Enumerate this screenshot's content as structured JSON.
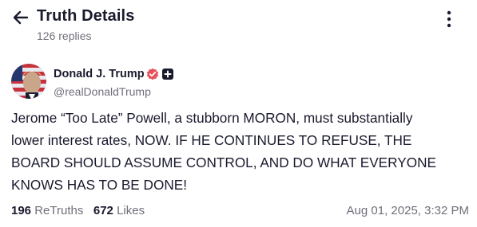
{
  "header": {
    "title": "Truth Details",
    "replies": "126 replies",
    "back_icon": "arrow-left-icon",
    "more_icon": "vertical-ellipsis-icon"
  },
  "post": {
    "author_name": "Donald J. Trump",
    "author_handle": "@realDonaldTrump",
    "verified_icon": "verified-badge-icon",
    "verified_color": "#e8505b",
    "plus_icon": "plus-badge-icon",
    "text_lines": [
      "Jerome “Too Late” Powell, a stubborn MORON, must substantially",
      "lower interest rates, NOW. IF HE CONTINUES TO REFUSE, THE",
      "BOARD SHOULD ASSUME CONTROL, AND DO WHAT EVERYONE",
      "KNOWS HAS TO BE DONE!"
    ],
    "retruths_count": "196",
    "retruths_label": "ReTruths",
    "likes_count": "672",
    "likes_label": "Likes",
    "timestamp": "Aug 01, 2025, 3:32 PM"
  },
  "colors": {
    "text_primary": "#1a1a2e",
    "text_secondary": "#6f6f7a",
    "background": "#ffffff"
  }
}
